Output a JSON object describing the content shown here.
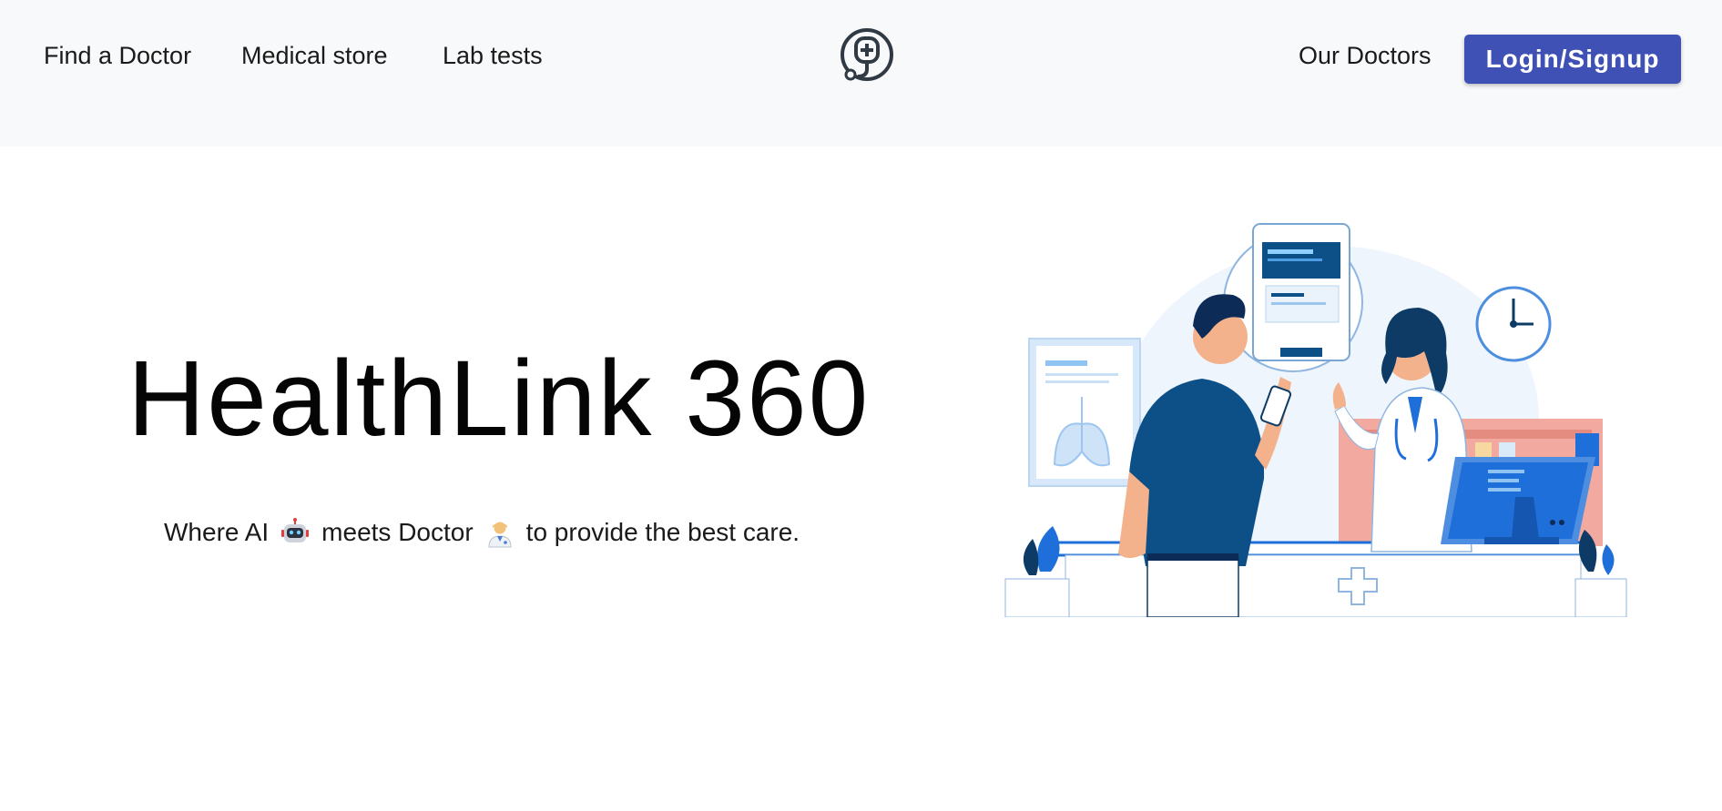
{
  "nav": {
    "left_links": [
      "Find a Doctor",
      "Medical store",
      "Lab tests"
    ],
    "right_link": "Our Doctors",
    "login_label": "Login/Signup",
    "logo_icon": "stethoscope-cross-icon"
  },
  "hero": {
    "title": "HealthLink 360",
    "subtitle_part1": "Where AI",
    "subtitle_emoji1": "robot-emoji-icon",
    "subtitle_part2": "meets Doctor",
    "subtitle_emoji2": "doctor-emoji-icon",
    "subtitle_part3": "to provide the best care."
  },
  "illustration": "doctor-patient-pharmacy-illustration",
  "colors": {
    "navbar_bg": "#f8f9fa",
    "accent": "#3f51b5",
    "illustration_blue": "#1e6fd9",
    "illustration_navy": "#0d3b66"
  }
}
